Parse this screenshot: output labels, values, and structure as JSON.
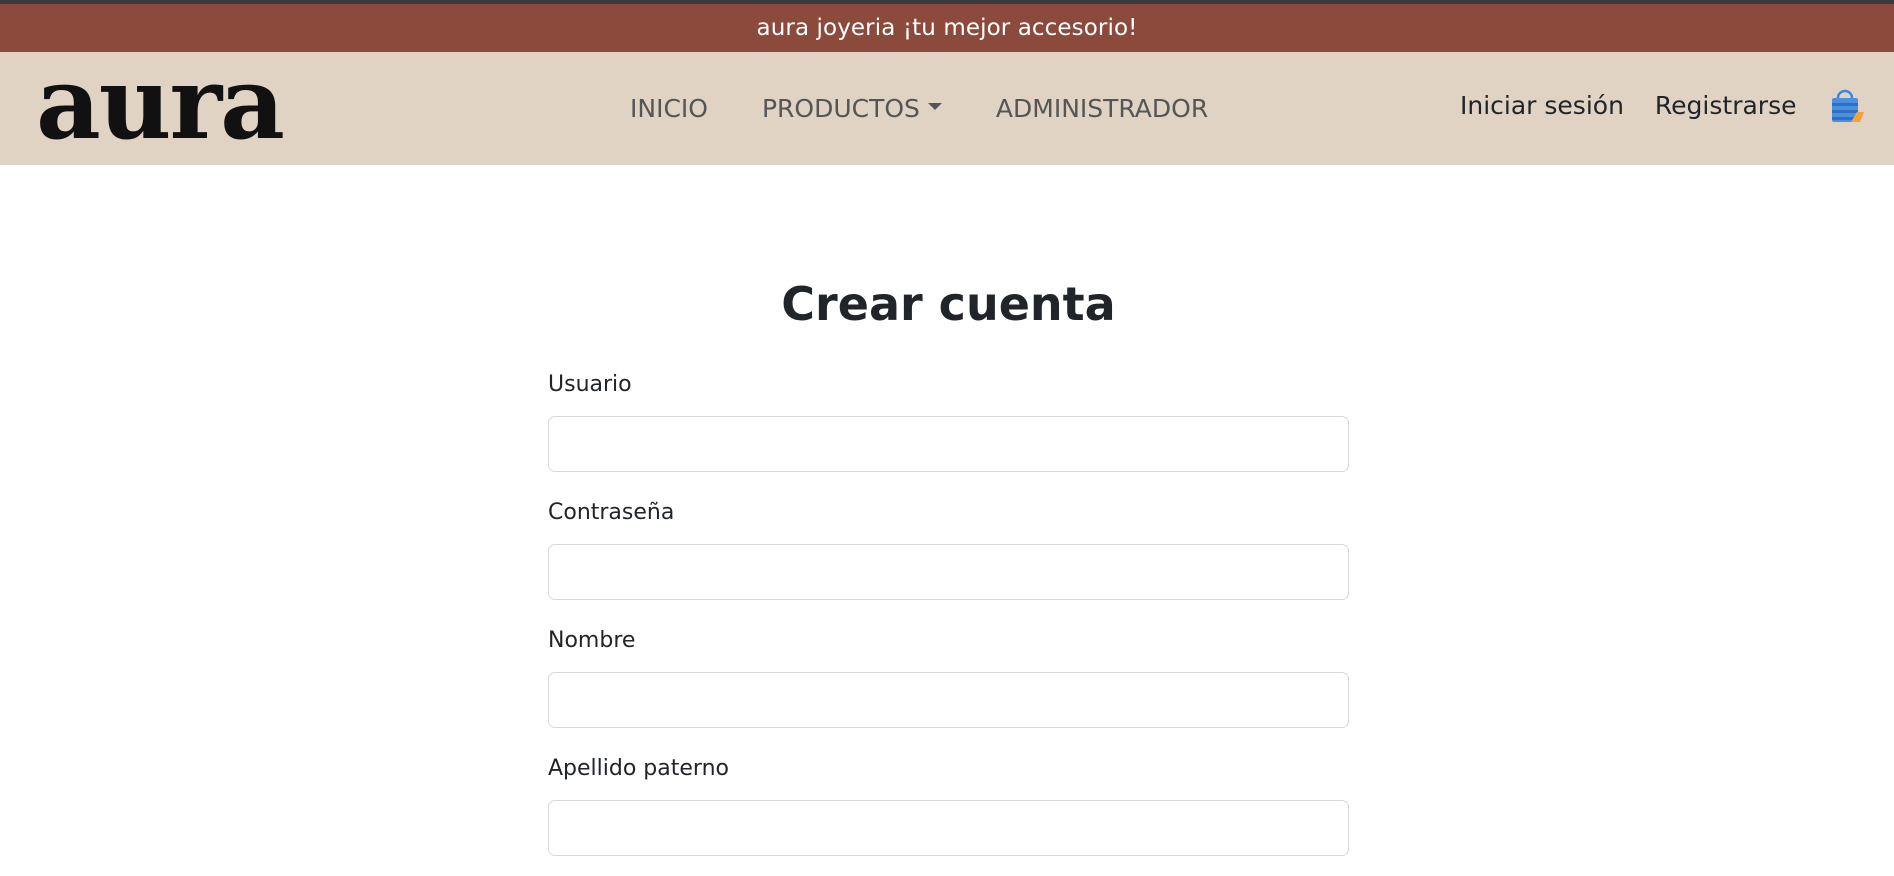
{
  "promo": {
    "text": "aura joyeria ¡tu mejor accesorio!"
  },
  "brand": {
    "logo_text": "aura"
  },
  "nav": {
    "inicio": "INICIO",
    "productos": "PRODUCTOS",
    "administrador": "ADMINISTRADOR",
    "iniciar_sesion": "Iniciar sesión",
    "registrarse": "Registrarse",
    "cart_icon": "shopping-bag-icon"
  },
  "form": {
    "title": "Crear cuenta",
    "fields": [
      {
        "label": "Usuario",
        "value": ""
      },
      {
        "label": "Contraseña",
        "value": ""
      },
      {
        "label": "Nombre",
        "value": ""
      },
      {
        "label": "Apellido paterno",
        "value": ""
      }
    ]
  },
  "colors": {
    "promo_bg": "#8c4a3c",
    "navbar_bg": "#e0d3c3",
    "text": "#212529"
  }
}
